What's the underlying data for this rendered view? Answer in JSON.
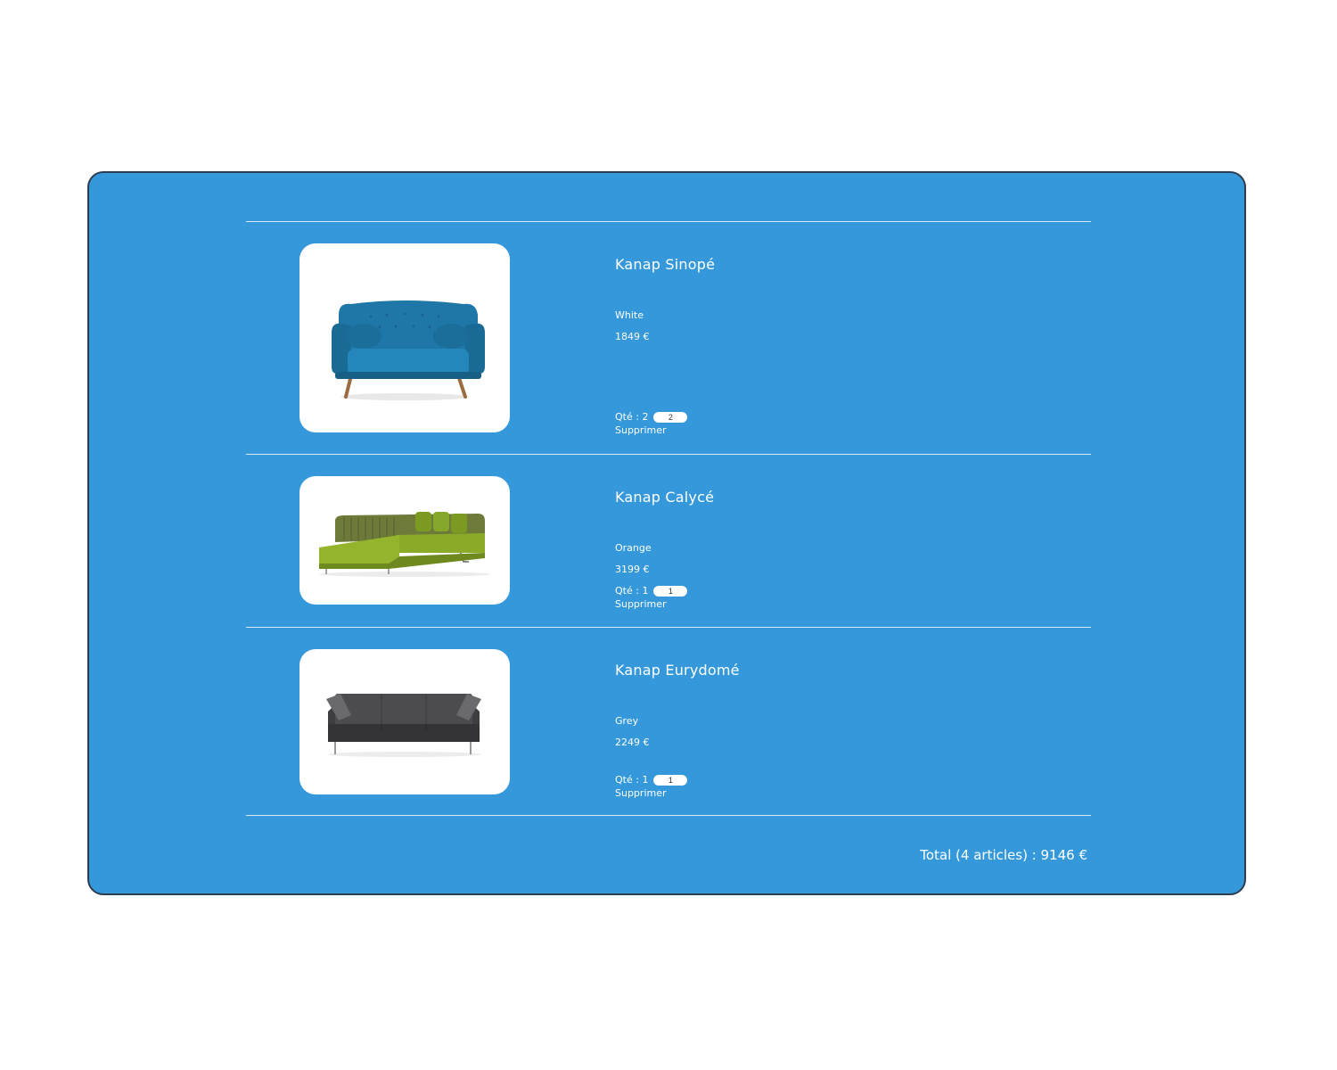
{
  "cart": {
    "items": [
      {
        "name": "Kanap Sinopé",
        "color": "White",
        "price": "1849 €",
        "qty_label": "Qté : 2",
        "qty_value": "2",
        "delete_label": "Supprimer",
        "image_icon": "blue-sofa-image",
        "sofa_color": "#1f77a8"
      },
      {
        "name": "Kanap Calycé",
        "color": "Orange",
        "price": "3199 €",
        "qty_label": "Qté : 1",
        "qty_value": "1",
        "delete_label": "Supprimer",
        "image_icon": "green-corner-sofa-image",
        "sofa_color": "#7a9a22"
      },
      {
        "name": "Kanap Eurydomé",
        "color": "Grey",
        "price": "2249 €",
        "qty_label": "Qté : 1",
        "qty_value": "1",
        "delete_label": "Supprimer",
        "image_icon": "grey-sofa-image",
        "sofa_color": "#505050"
      }
    ],
    "total": "Total (4 articles) : 9146 €"
  },
  "colors": {
    "panel_background": "#3498db",
    "panel_border": "#2c3e50",
    "text": "#ffffff"
  }
}
